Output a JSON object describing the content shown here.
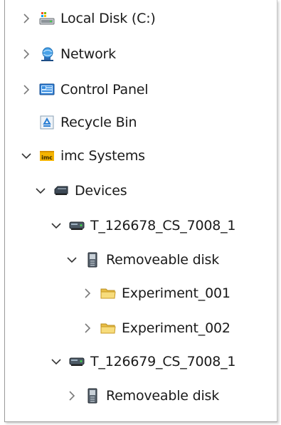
{
  "tree": {
    "items": [
      {
        "label": "Local Disk (C:)",
        "icon": "local-disk-icon",
        "expander": "collapsed"
      },
      {
        "label": "Network",
        "icon": "network-icon",
        "expander": "collapsed"
      },
      {
        "label": "Control Panel",
        "icon": "control-panel-icon",
        "expander": "collapsed"
      },
      {
        "label": "Recycle Bin",
        "icon": "recycle-bin-icon",
        "expander": "none"
      },
      {
        "label": "imc Systems",
        "icon": "imc-icon",
        "expander": "expanded"
      },
      {
        "label": "Devices",
        "icon": "devices-icon",
        "expander": "expanded"
      },
      {
        "label": "T_126678_CS_7008_1",
        "icon": "device-icon",
        "expander": "expanded"
      },
      {
        "label": "Removeable disk",
        "icon": "removable-disk-icon",
        "expander": "expanded"
      },
      {
        "label": "Experiment_001",
        "icon": "folder-icon",
        "expander": "collapsed"
      },
      {
        "label": "Experiment_002",
        "icon": "folder-icon",
        "expander": "collapsed"
      },
      {
        "label": "T_126679_CS_7008_1",
        "icon": "device-icon",
        "expander": "expanded"
      },
      {
        "label": "Removeable disk",
        "icon": "removable-disk-icon",
        "expander": "collapsed"
      }
    ]
  },
  "colors": {
    "text": "#1a1a1a",
    "chevron": "#7a7a7a",
    "folder": "#f4d36b",
    "imc_brand": "#f5b400"
  }
}
